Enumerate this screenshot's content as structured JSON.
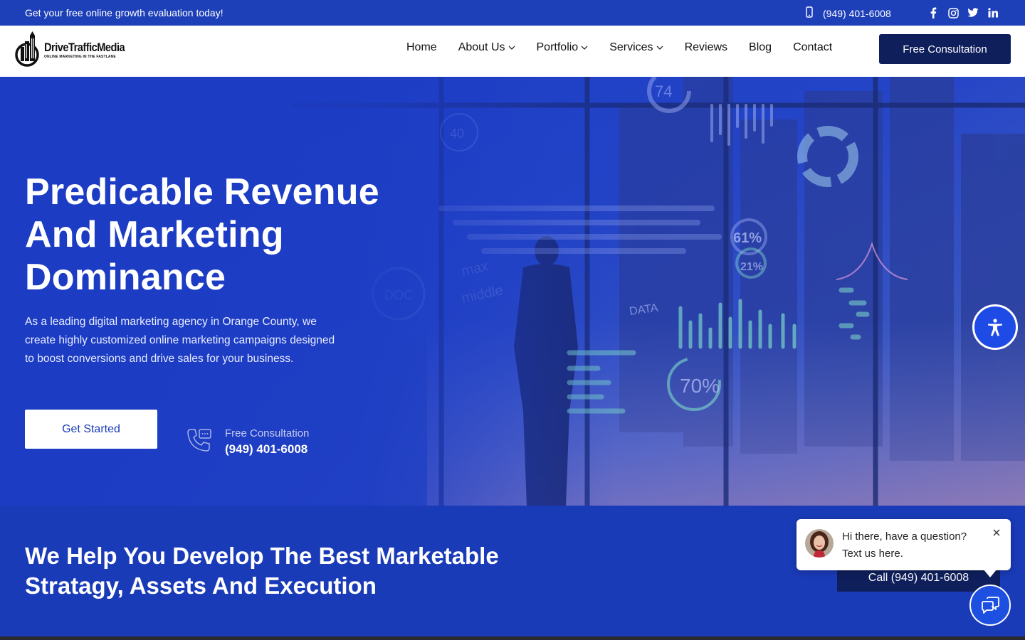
{
  "topbar": {
    "promo": "Get your free online growth evaluation today!",
    "phone": "(949) 401-6008",
    "socials": [
      {
        "name": "facebook-icon",
        "glyph": "f"
      },
      {
        "name": "instagram-icon",
        "glyph": "◎"
      },
      {
        "name": "twitter-icon",
        "glyph": "🐦"
      },
      {
        "name": "linkedin-icon",
        "glyph": "in"
      }
    ]
  },
  "nav": {
    "logo_name": "DriveTrafficMedia",
    "logo_tagline": "ONLINE MARKETING IN THE FASTLANE",
    "items": [
      {
        "label": "Home",
        "dropdown": false
      },
      {
        "label": "About Us",
        "dropdown": true
      },
      {
        "label": "Portfolio",
        "dropdown": true
      },
      {
        "label": "Services",
        "dropdown": true
      },
      {
        "label": "Reviews",
        "dropdown": false
      },
      {
        "label": "Blog",
        "dropdown": false
      },
      {
        "label": "Contact",
        "dropdown": false
      }
    ],
    "cta": "Free Consultation"
  },
  "hero": {
    "title": "Predicable Revenue And Marketing Dominance",
    "description": "As a leading digital marketing agency in Orange County, we create highly customized online marketing campaigns designed to boost conversions and drive sales for your business.",
    "primary_button": "Get Started",
    "consult_label": "Free Consultation",
    "consult_phone": "(949) 401-6008",
    "overlay_readouts": [
      "74",
      "40",
      "61%",
      "21%",
      "70%",
      "DOC",
      "DATA",
      "max",
      "middle"
    ]
  },
  "section2": {
    "title": "We Help You Develop The Best Marketable Stratagy, Assets And Execution",
    "call_button": "Call (949) 401-6008"
  },
  "chat": {
    "message": "Hi there, have a question? Text us here."
  },
  "colors": {
    "brand_blue": "#1a3bb8",
    "navy": "#0f1f5c",
    "accent_teal": "#7fd8c8"
  }
}
